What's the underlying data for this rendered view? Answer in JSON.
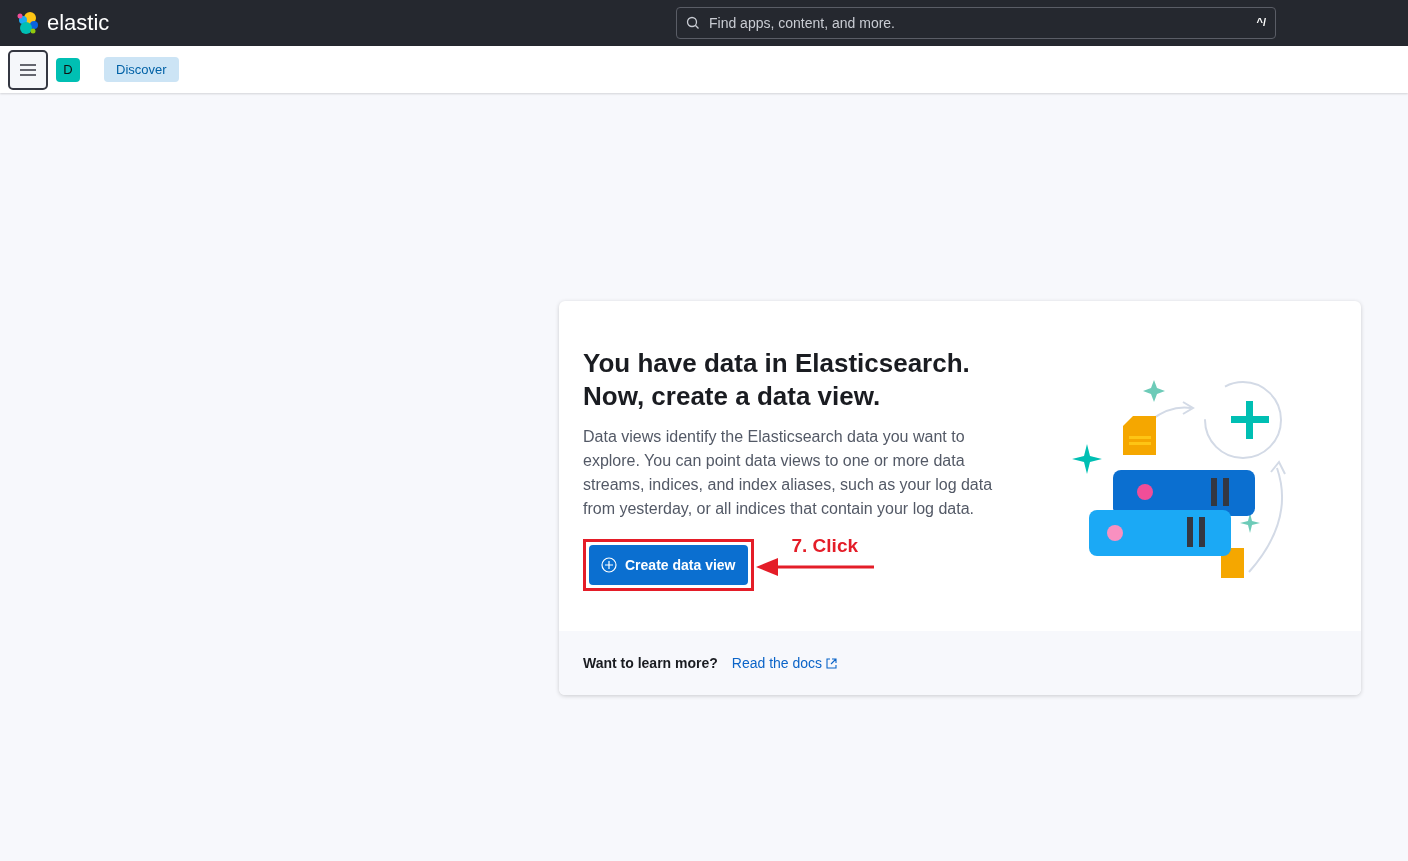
{
  "header": {
    "logo_text": "elastic",
    "search": {
      "placeholder": "Find apps, content, and more.",
      "shortcut": "^/"
    }
  },
  "subheader": {
    "space_initial": "D",
    "breadcrumb": "Discover"
  },
  "card": {
    "title": "You have data in Elasticsearch. Now, create a data view.",
    "description": "Data views identify the Elasticsearch data you want to explore. You can point data views to one or more data streams, indices, and index aliases, such as your log data from yesterday, or all indices that contain your log data.",
    "button": "Create data view",
    "annotation": "7. Click",
    "footer": {
      "label": "Want to learn more?",
      "link": "Read the docs"
    }
  }
}
